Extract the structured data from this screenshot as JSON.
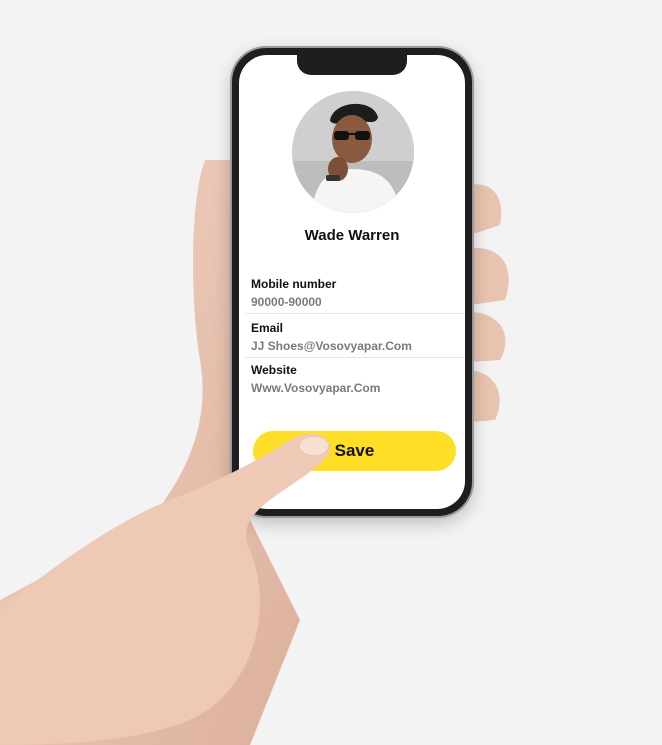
{
  "profile": {
    "name": "Wade Warren",
    "avatar_icon": "user-photo-icon"
  },
  "fields": [
    {
      "label": "Mobile number",
      "value": "90000-90000"
    },
    {
      "label": "Email",
      "value": "JJ Shoes@Vosovyapar.Com"
    },
    {
      "label": "Website",
      "value": "Www.Vosovyapar.Com"
    }
  ],
  "actions": {
    "save_label": "Save"
  },
  "colors": {
    "accent": "#ffdf26",
    "background": "#f3f3f3",
    "text_primary": "#111111",
    "text_secondary": "#7a7a7a"
  }
}
